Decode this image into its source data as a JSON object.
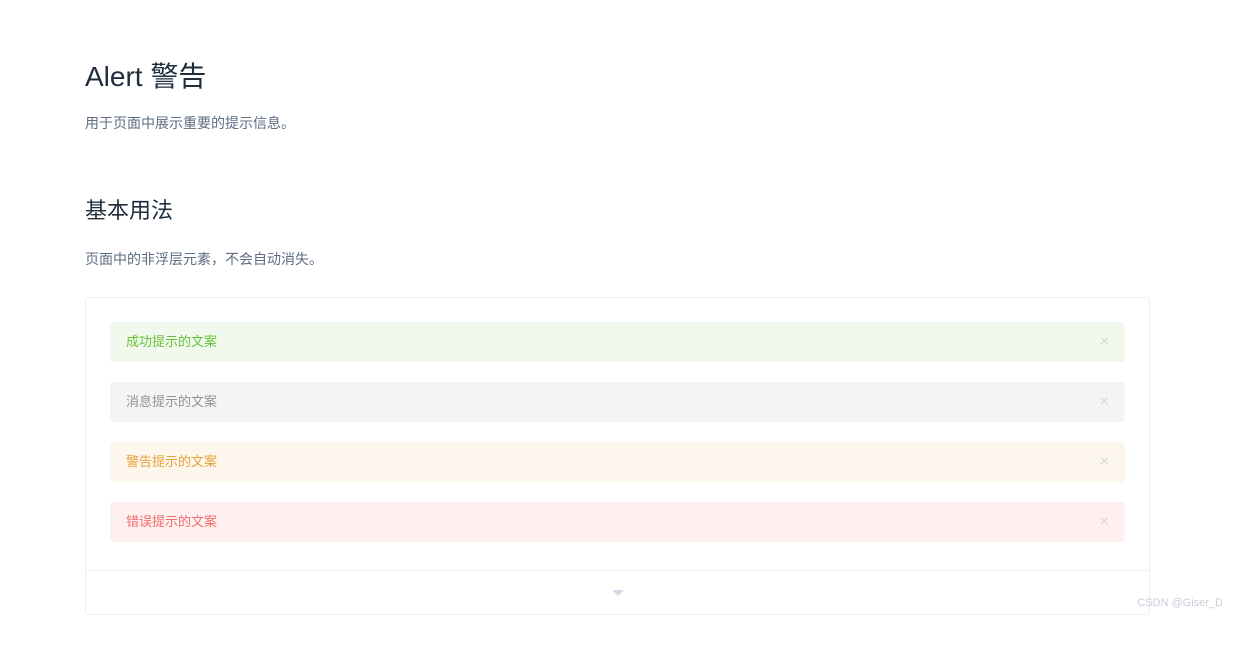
{
  "header": {
    "title": "Alert 警告",
    "description": "用于页面中展示重要的提示信息。"
  },
  "section": {
    "title": "基本用法",
    "description": "页面中的非浮层元素，不会自动消失。"
  },
  "alerts": {
    "success": "成功提示的文案",
    "info": "消息提示的文案",
    "warning": "警告提示的文案",
    "error": "错误提示的文案"
  },
  "watermark": "CSDN @Giser_D"
}
